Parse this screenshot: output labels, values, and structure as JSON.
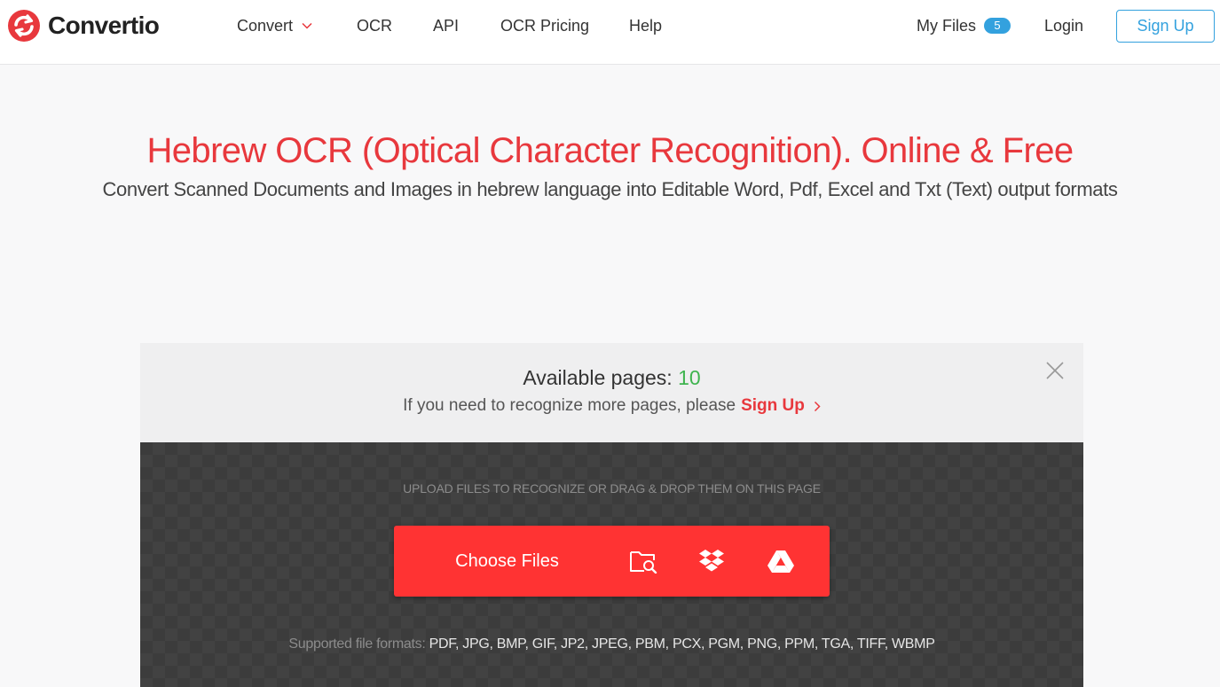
{
  "header": {
    "logo_text": "Convertio",
    "nav": {
      "convert": "Convert",
      "ocr": "OCR",
      "api": "API",
      "ocr_pricing": "OCR Pricing",
      "help": "Help"
    },
    "my_files": "My Files",
    "my_files_count": "5",
    "login": "Login",
    "sign_up": "Sign Up"
  },
  "hero": {
    "title": "Hebrew OCR (Optical Character Recognition). Online & Free",
    "subtitle": "Convert Scanned Documents and Images in hebrew language into Editable Word, Pdf, Excel and Txt (Text) output formats"
  },
  "limit": {
    "title": "Available pages:",
    "pages": "10",
    "text": "If you need to recognize more pages, please",
    "sign_up": "Sign Up"
  },
  "upload": {
    "hint": "UPLOAD FILES TO RECOGNIZE OR DRAG & DROP THEM ON THIS PAGE",
    "choose_files": "Choose Files",
    "icons": [
      "folder-search-icon",
      "dropbox-icon",
      "google-drive-icon"
    ],
    "formats_label": "Supported file formats:",
    "formats_list": "PDF, JPG, BMP, GIF, JP2, JPEG, PBM, PCX, PGM, PNG, PPM, TGA, TIFF, WBMP"
  },
  "colors": {
    "brand_red": "#e8383d",
    "button_red": "#ff3333",
    "accent_blue": "#33a1de",
    "pages_green": "#3fb44f",
    "dropzone_dark": "#3c3c3c"
  }
}
